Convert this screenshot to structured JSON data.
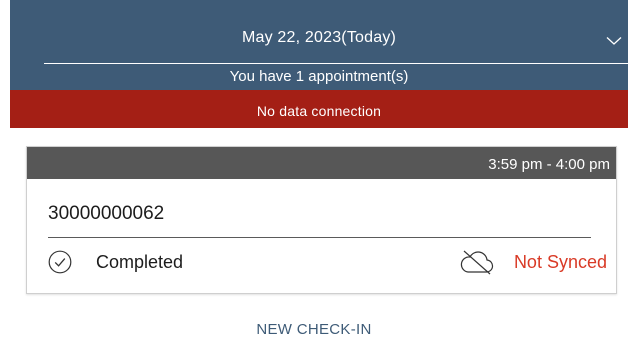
{
  "header": {
    "date_label": "May 22, 2023(Today)",
    "dropdown_icon": "chevron-down-icon",
    "appointment_count_text": "You have 1 appointment(s)",
    "background_color": "#3e5b77"
  },
  "banner": {
    "text": "No data connection",
    "background_color": "#a41f15"
  },
  "appointments": [
    {
      "time_range": "3:59 pm - 4:00 pm",
      "id": "30000000062",
      "status": "Completed",
      "status_icon": "check-circle-icon",
      "sync_status": "Not Synced",
      "sync_icon": "cloud-off-icon",
      "sync_color": "#d93a26"
    }
  ],
  "footer": {
    "new_checkin_label": "NEW CHECK-IN"
  }
}
